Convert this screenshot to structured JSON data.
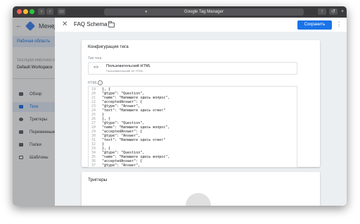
{
  "browser": {
    "url_title": "Google Tag Manager",
    "nav_back": "‹",
    "nav_forward": "›",
    "share": "↑",
    "refresh": "↺",
    "new_tab": "+"
  },
  "app": {
    "back": "←",
    "title": "Менед",
    "workspace_tab": "Рабочая область",
    "workspace_label": "ТЕКУЩАЯ РАБОЧАЯ ОБ",
    "workspace_name": "Default Workspace",
    "nav": [
      {
        "label": "Обзор",
        "icon": "overview-icon"
      },
      {
        "label": "Теги",
        "icon": "tags-icon",
        "active": true
      },
      {
        "label": "Триггеры",
        "icon": "triggers-icon"
      },
      {
        "label": "Переменные",
        "icon": "variables-icon"
      },
      {
        "label": "Папки",
        "icon": "folders-icon"
      },
      {
        "label": "Шаблоны",
        "icon": "templates-icon"
      }
    ]
  },
  "panel": {
    "close": "✕",
    "title": "FAQ Schema",
    "save_label": "Сохранить",
    "menu": "⋮",
    "config": {
      "title": "Конфигурация тега",
      "tag_type_label": "Тип тега",
      "tag_type_icon": "<>",
      "tag_type_name": "Пользовательский HTML",
      "tag_type_sub": "Пользовательский тег HTML",
      "html_label": "HTML",
      "help": "?"
    },
    "triggers": {
      "title": "Триггеры"
    }
  },
  "code_lines": [
    {
      "n": "19",
      "text": "  }, {"
    },
    {
      "n": "20",
      "text": "  \"@type\": \"Question\","
    },
    {
      "n": "21",
      "text": "  \"name\": \"Напишите здесь вопрос\","
    },
    {
      "n": "22",
      "text": "  \"acceptedAnswer\": {"
    },
    {
      "n": "23",
      "text": "  \"@type\": \"Answer\","
    },
    {
      "n": "24",
      "text": "  \"text\": \"Напишите здесь ответ\""
    },
    {
      "n": "25",
      "text": "  }"
    },
    {
      "n": "26",
      "text": "  }, {"
    },
    {
      "n": "27",
      "text": "  \"@type\": \"Question\","
    },
    {
      "n": "28",
      "text": "  \"name\": \"Напишите здесь вопрос\","
    },
    {
      "n": "29",
      "text": "  \"acceptedAnswer\": {"
    },
    {
      "n": "30",
      "text": "  \"@type\": \"Answer\","
    },
    {
      "n": "31",
      "text": "  \"text\": \"Напишите здесь ответ\""
    },
    {
      "n": "32",
      "text": "  }"
    },
    {
      "n": "33",
      "text": "  }, {"
    },
    {
      "n": "34",
      "text": "  \"@type\": \"Question\","
    },
    {
      "n": "35",
      "text": "  \"name\": \"Напишите здесь вопрос\","
    },
    {
      "n": "36",
      "text": "  \"acceptedAnswer\": {"
    },
    {
      "n": "37",
      "text": "  \"@type\": \"Answer\","
    }
  ]
}
